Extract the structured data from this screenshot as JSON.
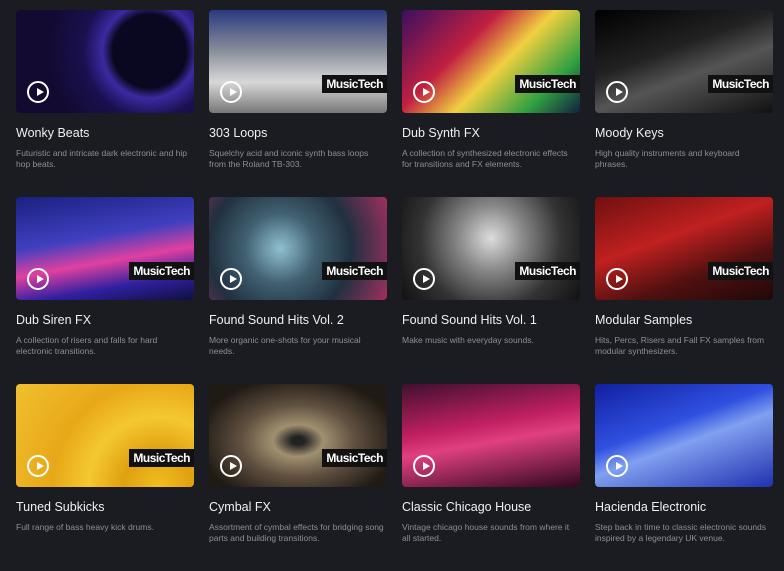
{
  "brand": "MusicTech",
  "cards": [
    {
      "title": "Wonky Beats",
      "desc": "Futuristic and intricate dark electronic and hip hop beats.",
      "badge": false,
      "bg": "radial-gradient(circle at 75% 40%,#0a0820 25%,#3a2aa0 32%,#1a1050 45%,#120a30 70%)"
    },
    {
      "title": "303 Loops",
      "desc": "Squelchy acid and iconic synth bass loops from the Roland TB-303.",
      "badge": true,
      "bg": "linear-gradient(180deg,#2a3a80 0%,#8a8f9a 40%,#d8d8d8 70%,#777 100%)"
    },
    {
      "title": "Dub Synth FX",
      "desc": "A collection of synthesized electronic effects for transitions and FX elements.",
      "badge": true,
      "bg": "linear-gradient(135deg,#3a1060 0%,#c02040 35%,#f0d040 55%,#30a040 80%,#102040 100%)"
    },
    {
      "title": "Moody Keys",
      "desc": "High quality instruments and keyboard phrases.",
      "badge": true,
      "bg": "linear-gradient(160deg,#000 0%,#222 40%,#555 60%,#111 100%)"
    },
    {
      "title": "Dub Siren FX",
      "desc": "A collection of risers and falls for hard electronic transitions.",
      "badge": true,
      "bg": "linear-gradient(170deg,#1a2080 0%,#4040c0 40%,#e040a0 60%,#3020a0 80%,#101040 100%)"
    },
    {
      "title": "Found Sound Hits Vol. 2",
      "desc": "More organic one-shots for your musical needs.",
      "badge": true,
      "bg": "radial-gradient(circle at 40% 50%,#90c0d0 0%,#406070 30%,#203040 60%,#a03060 100%)"
    },
    {
      "title": "Found Sound Hits Vol. 1",
      "desc": "Make music with everyday sounds.",
      "badge": true,
      "bg": "radial-gradient(circle at 50% 40%,#ddd 0%,#888 30%,#333 65%,#111 100%)"
    },
    {
      "title": "Modular Samples",
      "desc": "Hits, Percs, Risers and Fall FX samples from modular synthesizers.",
      "badge": true,
      "bg": "linear-gradient(160deg,#701010 0%,#c02020 40%,#501010 70%,#200808 100%)"
    },
    {
      "title": "Tuned Subkicks",
      "desc": "Full range of bass heavy kick drums.",
      "badge": true,
      "bg": "radial-gradient(circle at 80% 100%,#f0c020 0%,#e0a010 20%,#f4c830 40%,#e8a818 60%,#f0c030 100%)"
    },
    {
      "title": "Cymbal FX",
      "desc": "Assortment of cymbal effects for bridging song parts and building transitions.",
      "badge": true,
      "bg": "radial-gradient(ellipse at 50% 55%,#222 5%,#a09070 20%,#605040 45%,#201a14 80%)"
    },
    {
      "title": "Classic Chicago House",
      "desc": "Vintage chicago house sounds from where it all started.",
      "badge": false,
      "bg": "linear-gradient(170deg,#401030 0%,#c02060 40%,#e04080 55%,#300820 100%)"
    },
    {
      "title": "Hacienda Electronic",
      "desc": "Step back in time to classic electronic sounds inspired by a legendary UK venue.",
      "badge": false,
      "bg": "linear-gradient(160deg,#1020a0 0%,#3050e0 40%,#80a0f0 55%,#2030b0 100%)"
    }
  ]
}
